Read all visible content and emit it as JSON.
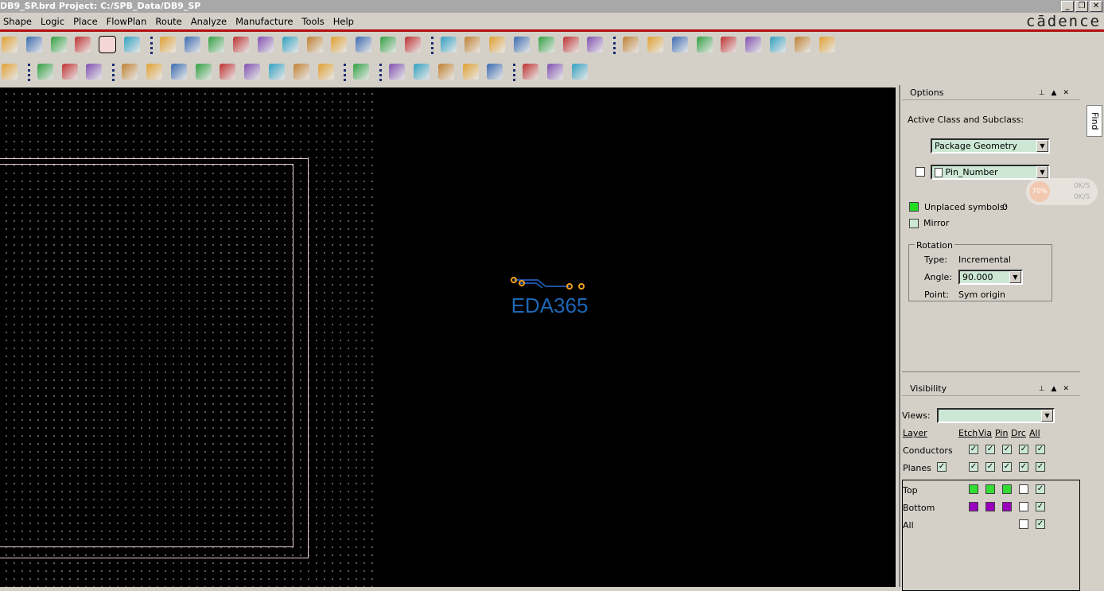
{
  "window": {
    "title": "DB9_SP.brd  Project: C:/SPB_Data/DB9_SP",
    "controls": [
      "_",
      "❐",
      "✕"
    ],
    "brand": "cādence"
  },
  "menu": [
    "Shape",
    "Logic",
    "Place",
    "FlowPlan",
    "Route",
    "Analyze",
    "Manufacture",
    "Tools",
    "Help"
  ],
  "toolbar1": [
    "undo-icon",
    "down-arrow-icon",
    "redo-icon",
    "down-arrow-icon",
    "shape-fill-icon",
    "pin-icon",
    "sep",
    "grid-icon",
    "board-grid-icon",
    "zoom-window-icon",
    "zoom-fit-icon",
    "zoom-in-icon",
    "zoom-out-icon",
    "zoom-prev-icon",
    "zoom-world-icon",
    "refresh-icon",
    "3d-icon",
    "flip-icon",
    "sep",
    "grid-settings-icon",
    "color-icon",
    "layers-icon",
    "stack-icon",
    "cm-icon",
    "dfa-icon",
    "globe-icon",
    "sep",
    "info-icon",
    "show-element-icon",
    "measure-icon",
    "wand-icon",
    "light-icon",
    "shadow-icon",
    "bars-icon",
    "timer-icon",
    "drc-icon"
  ],
  "toolbar2": [
    "delete-icon",
    "sep",
    "component-icon",
    "dim-icon",
    "measure-line-icon",
    "sep",
    "odb-icon",
    "split-icon",
    "tools-icon",
    "camera-icon",
    "renumber-icon",
    "list-icon",
    "matrix-icon",
    "testpoint-icon",
    "array-icon",
    "sep",
    "route-icon",
    "sep",
    "report-icon",
    "book-icon",
    "compare-icon",
    "check-icon",
    "wire-icon",
    "sep",
    "windows-icon",
    "mail-icon",
    "help-icon"
  ],
  "logo": {
    "text": "EDA365"
  },
  "options": {
    "title": "Options",
    "active_class_label": "Active Class and Subclass:",
    "class_value": "Package Geometry",
    "subclass_value": "Pin_Number",
    "unplaced_label": "Unplaced symbols:",
    "unplaced_count": "0",
    "mirror_label": "Mirror",
    "rotation_label": "Rotation",
    "type_label": "Type:",
    "type_value": "Incremental",
    "angle_label": "Angle:",
    "angle_value": "90.000",
    "point_label": "Point:",
    "point_value": "Sym origin",
    "find_tab": "Find"
  },
  "netmon": {
    "percent": "70%",
    "up": "0K/S",
    "down": "0K/S"
  },
  "visibility": {
    "title": "Visibility",
    "views_label": "Views:",
    "views_value": "",
    "layer_header": "Layer",
    "columns": [
      "Etch",
      "Via",
      "Pin",
      "Drc",
      "All"
    ],
    "rows": [
      {
        "name": "Conductors"
      },
      {
        "name": "Planes"
      },
      {
        "name": "Top"
      },
      {
        "name": "Bottom"
      },
      {
        "name": "All"
      }
    ]
  },
  "colors": {
    "top": "#33dd33",
    "bottom": "#9900bb",
    "accent": "#b01010"
  }
}
